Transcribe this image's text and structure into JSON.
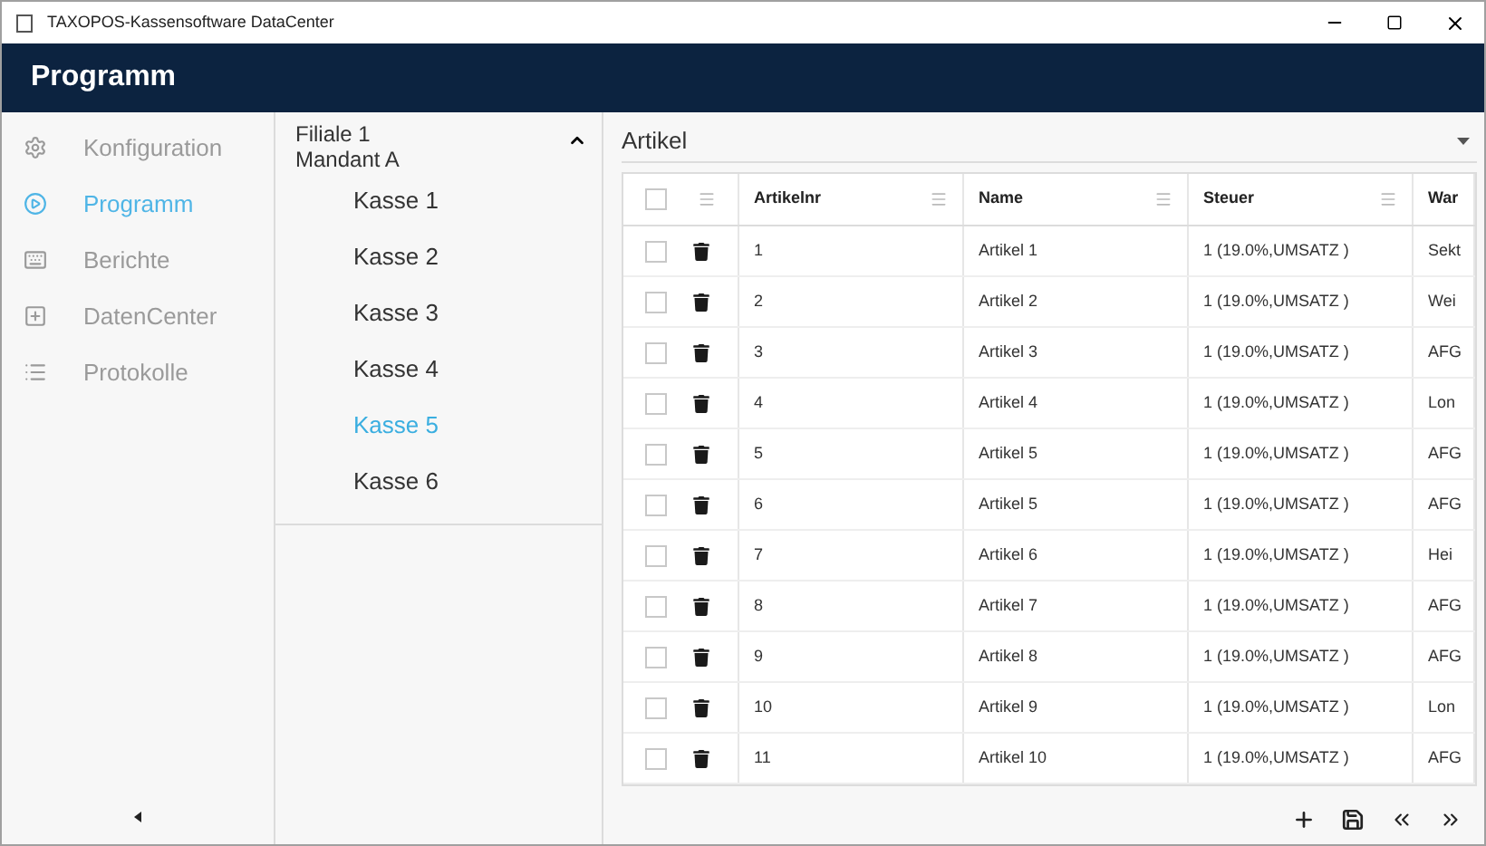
{
  "window": {
    "title": "TAXOPOS-Kassensoftware DataCenter"
  },
  "header": {
    "title": "Programm"
  },
  "sidebar": {
    "items": [
      {
        "label": "Konfiguration",
        "selected": false
      },
      {
        "label": "Programm",
        "selected": true
      },
      {
        "label": "Berichte",
        "selected": false
      },
      {
        "label": "DatenCenter",
        "selected": false
      },
      {
        "label": "Protokolle",
        "selected": false
      }
    ]
  },
  "branch": {
    "title": "Filiale 1",
    "subtitle": "Mandant A",
    "expanded": true,
    "registers": [
      {
        "label": "Kasse 1",
        "selected": false
      },
      {
        "label": "Kasse 2",
        "selected": false
      },
      {
        "label": "Kasse 3",
        "selected": false
      },
      {
        "label": "Kasse 4",
        "selected": false
      },
      {
        "label": "Kasse 5",
        "selected": true
      },
      {
        "label": "Kasse 6",
        "selected": false
      }
    ]
  },
  "table": {
    "selector": "Artikel",
    "all_checked": false,
    "columns": [
      "Artikelnr",
      "Name",
      "Steuer",
      "War"
    ],
    "rows": [
      {
        "checked": false,
        "cells": [
          "1",
          "Artikel 1",
          "1 (19.0%,UMSATZ )",
          "Sekt"
        ]
      },
      {
        "checked": false,
        "cells": [
          "2",
          "Artikel 2",
          "1 (19.0%,UMSATZ )",
          "Wei"
        ]
      },
      {
        "checked": false,
        "cells": [
          "3",
          "Artikel 3",
          "1 (19.0%,UMSATZ )",
          "AFG"
        ]
      },
      {
        "checked": false,
        "cells": [
          "4",
          "Artikel 4",
          "1 (19.0%,UMSATZ )",
          "Lon"
        ]
      },
      {
        "checked": false,
        "cells": [
          "5",
          "Artikel 5",
          "1 (19.0%,UMSATZ )",
          "AFG"
        ]
      },
      {
        "checked": false,
        "cells": [
          "6",
          "Artikel 5",
          "1 (19.0%,UMSATZ )",
          "AFG"
        ]
      },
      {
        "checked": false,
        "cells": [
          "7",
          "Artikel 6",
          "1 (19.0%,UMSATZ )",
          "Hei"
        ]
      },
      {
        "checked": false,
        "cells": [
          "8",
          "Artikel 7",
          "1 (19.0%,UMSATZ )",
          "AFG"
        ]
      },
      {
        "checked": false,
        "cells": [
          "9",
          "Artikel 8",
          "1 (19.0%,UMSATZ )",
          "AFG"
        ]
      },
      {
        "checked": false,
        "cells": [
          "10",
          "Artikel 9",
          "1 (19.0%,UMSATZ )",
          "Lon"
        ]
      },
      {
        "checked": false,
        "cells": [
          "11",
          "Artikel 10",
          "1 (19.0%,UMSATZ )",
          "AFG"
        ]
      }
    ]
  }
}
